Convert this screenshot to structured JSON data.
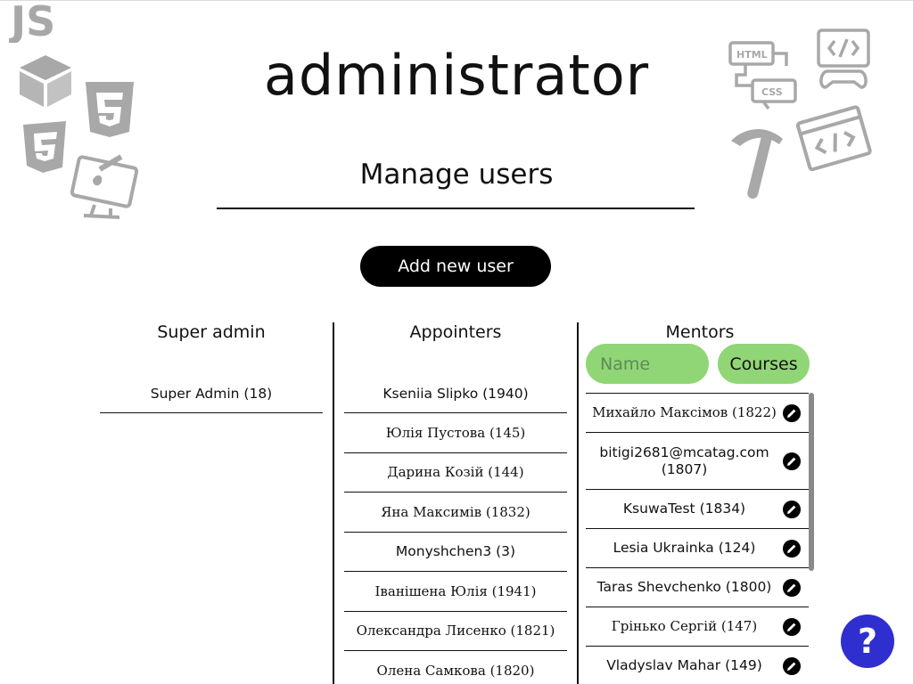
{
  "header": {
    "title": "administrator",
    "subtitle": "Manage users",
    "add_button": "Add new user"
  },
  "decor": {
    "left_icons": [
      "js-icon",
      "cube-icon",
      "html5-icon",
      "css3-icon",
      "design-monitor-icon"
    ],
    "right_icons": [
      "html-css-flow-icon",
      "code-gamepad-icon",
      "pickaxe-icon",
      "code-window-icon"
    ],
    "labels": {
      "js": "JS",
      "html": "HTML",
      "css": "CSS"
    }
  },
  "columns": {
    "super_admin": {
      "header": "Super admin",
      "items": [
        "Super Admin (18)"
      ]
    },
    "appointers": {
      "header": "Appointers",
      "items": [
        "Kseniia Slipko (1940)",
        "Юлія Пустова (145)",
        "Дарина Козій (144)",
        "Яна Максимів (1832)",
        "Monyshchen3 (3)",
        "Іванішена Юлія (1941)",
        "Олександра Лисенко (1821)",
        "Олена Самкова (1820)"
      ]
    },
    "mentors": {
      "header": "Mentors",
      "filter_name_placeholder": "Name",
      "filter_courses_label": "Courses",
      "items": [
        "Михайло Максімов (1822)",
        "bitigi2681@mcatag.com (1807)",
        "KsuwaTest (1834)",
        "Lesia Ukrainka (124)",
        "Taras Shevchenko (1800)",
        "Грінько Сергій (147)",
        "Vladyslav Mahar (149)"
      ]
    }
  },
  "help_button": "?",
  "colors": {
    "accent_green": "#90d676",
    "help_blue": "#2f2fd0",
    "primary_black": "#000000",
    "decor_gray": "#a8a8a8"
  }
}
